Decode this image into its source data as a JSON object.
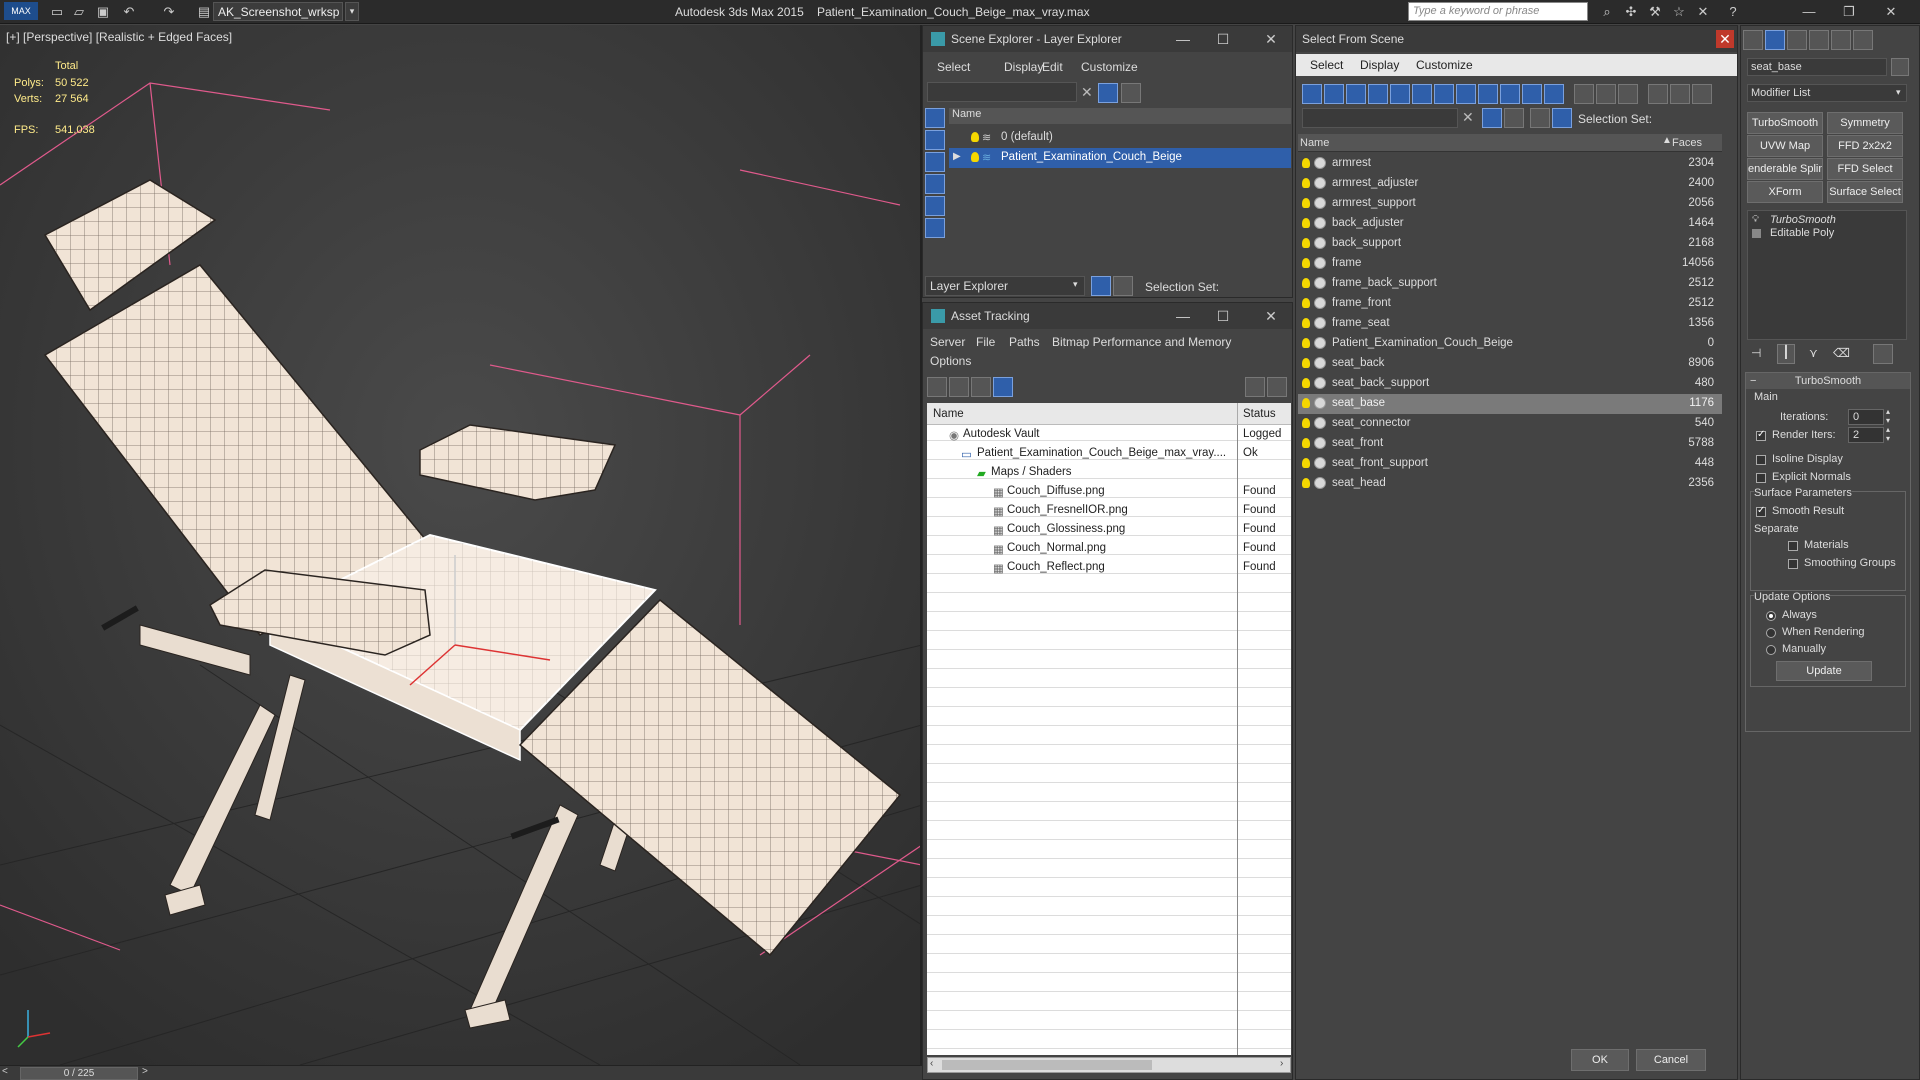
{
  "titlebar": {
    "workspace": "AK_Screenshot_wrksp",
    "app_title": "Autodesk 3ds Max  2015",
    "file_title": "Patient_Examination_Couch_Beige_max_vray.max",
    "search_placeholder": "Type a keyword or phrase",
    "logo": "MAX"
  },
  "viewport": {
    "label": "[+] [Perspective] [Realistic + Edged Faces]",
    "stats": {
      "total_label": "Total",
      "polys_label": "Polys:",
      "polys_value": "50 522",
      "verts_label": "Verts:",
      "verts_value": "27 564",
      "fps_label": "FPS:",
      "fps_value": "541,038"
    },
    "timeline": "0 / 225"
  },
  "scene_explorer": {
    "title": "Scene Explorer - Layer Explorer",
    "menu": [
      "Select",
      "Display",
      "Edit",
      "Customize"
    ],
    "column_name": "Name",
    "layers": [
      "0 (default)",
      "Patient_Examination_Couch_Beige"
    ],
    "footer_mode": "Layer Explorer",
    "selection_set_label": "Selection Set:"
  },
  "asset_tracking": {
    "title": "Asset Tracking",
    "menu": [
      "Server",
      "File",
      "Paths",
      "Bitmap Performance and Memory",
      "Options"
    ],
    "col_name": "Name",
    "col_status": "Status",
    "rows": [
      {
        "name": "Autodesk Vault",
        "status": "Logged"
      },
      {
        "name": "Patient_Examination_Couch_Beige_max_vray....",
        "status": "Ok"
      },
      {
        "name": "Maps / Shaders",
        "status": ""
      },
      {
        "name": "Couch_Diffuse.png",
        "status": "Found"
      },
      {
        "name": "Couch_FresnelIOR.png",
        "status": "Found"
      },
      {
        "name": "Couch_Glossiness.png",
        "status": "Found"
      },
      {
        "name": "Couch_Normal.png",
        "status": "Found"
      },
      {
        "name": "Couch_Reflect.png",
        "status": "Found"
      }
    ]
  },
  "select_from_scene": {
    "title": "Select From Scene",
    "menu": [
      "Select",
      "Display",
      "Customize"
    ],
    "selection_set_label": "Selection Set:",
    "col_name": "Name",
    "col_faces": "Faces",
    "objects": [
      {
        "name": "armrest",
        "faces": "2304"
      },
      {
        "name": "armrest_adjuster",
        "faces": "2400"
      },
      {
        "name": "armrest_support",
        "faces": "2056"
      },
      {
        "name": "back_adjuster",
        "faces": "1464"
      },
      {
        "name": "back_support",
        "faces": "2168"
      },
      {
        "name": "frame",
        "faces": "14056"
      },
      {
        "name": "frame_back_support",
        "faces": "2512"
      },
      {
        "name": "frame_front",
        "faces": "2512"
      },
      {
        "name": "frame_seat",
        "faces": "1356"
      },
      {
        "name": "Patient_Examination_Couch_Beige",
        "faces": "0"
      },
      {
        "name": "seat_back",
        "faces": "8906"
      },
      {
        "name": "seat_back_support",
        "faces": "480"
      },
      {
        "name": "seat_base",
        "faces": "1176"
      },
      {
        "name": "seat_connector",
        "faces": "540"
      },
      {
        "name": "seat_front",
        "faces": "5788"
      },
      {
        "name": "seat_front_support",
        "faces": "448"
      },
      {
        "name": "seat_head",
        "faces": "2356"
      }
    ],
    "ok": "OK",
    "cancel": "Cancel"
  },
  "modify_panel": {
    "object_name": "seat_base",
    "modifier_list": "Modifier List",
    "buttons": [
      "TurboSmooth",
      "Symmetry",
      "UVW Map",
      "FFD 2x2x2",
      "enderable Splin",
      "FFD Select",
      "XForm",
      "Surface Select"
    ],
    "stack": [
      "TurboSmooth",
      "Editable Poly"
    ],
    "rollout_title": "TurboSmooth",
    "main_label": "Main",
    "iterations_label": "Iterations:",
    "iterations_value": "0",
    "render_iters_label": "Render Iters:",
    "render_iters_value": "2",
    "isoline_label": "Isoline Display",
    "explicit_normals_label": "Explicit Normals",
    "surface_params_label": "Surface Parameters",
    "smooth_result_label": "Smooth Result",
    "separate_label": "Separate",
    "materials_label": "Materials",
    "smoothing_groups_label": "Smoothing Groups",
    "update_options_label": "Update Options",
    "always_label": "Always",
    "when_rendering_label": "When Rendering",
    "manually_label": "Manually",
    "update_button": "Update"
  },
  "colors": {
    "selection_blue": "#2f5faa",
    "stat_yellow": "#ffeb8a",
    "grid_pink": "#e05a8c"
  }
}
